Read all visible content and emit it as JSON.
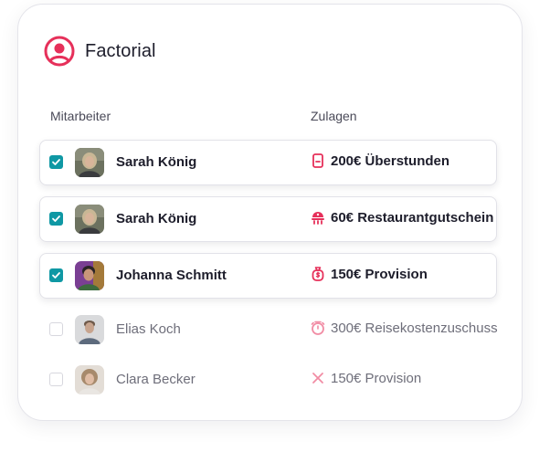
{
  "brand": {
    "name": "Factorial",
    "logo_icon": "user-circle-icon",
    "accent": "#e6305a"
  },
  "columns": {
    "employee": "Mitarbeiter",
    "allowance": "Zulagen"
  },
  "rows": [
    {
      "selected": true,
      "name": "Sarah König",
      "allowance": "200€ Überstunden",
      "icon": "document-icon"
    },
    {
      "selected": true,
      "name": "Sarah König",
      "allowance": "60€ Restaurantgutschein",
      "icon": "restaurant-icon"
    },
    {
      "selected": true,
      "name": "Johanna Schmitt",
      "allowance": "150€ Provision",
      "icon": "money-bag-icon"
    },
    {
      "selected": false,
      "name": "Elias Koch",
      "allowance": "300€ Reisekostenzuschuss",
      "icon": "stopwatch-icon"
    },
    {
      "selected": false,
      "name": "Clara Becker",
      "allowance": "150€ Provision",
      "icon": "close-icon"
    }
  ],
  "colors": {
    "checkbox": "#0f98a4",
    "icon": "#e6305a"
  }
}
